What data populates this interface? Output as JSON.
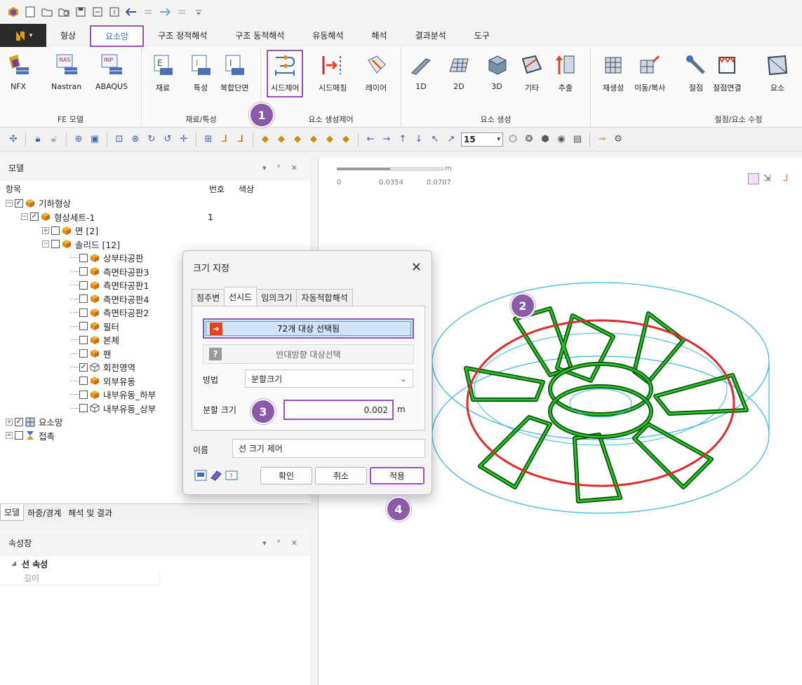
{
  "menu": {
    "tabs": [
      "형상",
      "요소망",
      "구조 정적해석",
      "구조 동적해석",
      "유동해석",
      "해석",
      "결과분석",
      "도구"
    ],
    "active_tab": "요소망"
  },
  "ribbon": {
    "groups": [
      {
        "label": "FE 모델",
        "buttons": [
          "NFX",
          "Nastran",
          "ABAQUS"
        ]
      },
      {
        "label": "재료/특성",
        "buttons": [
          "재료",
          "특성",
          "복합단면"
        ]
      },
      {
        "label": "요소 생성제어",
        "buttons": [
          "시드제어",
          "시드매칭",
          "레이어"
        ]
      },
      {
        "label": "요소 생성",
        "buttons": [
          "1D",
          "2D",
          "3D",
          "기타",
          "추출"
        ]
      },
      {
        "label": "절점/요소 수정",
        "buttons": [
          "재생성",
          "이동/복사",
          "절점",
          "절점연결",
          "요소"
        ]
      }
    ],
    "nas_tag": "NAS",
    "inp_tag": "INP"
  },
  "toolbar": {
    "zoom_value": "15"
  },
  "model_panel": {
    "title": "모델",
    "col_item": "항목",
    "col_number": "번호",
    "col_color": "색상",
    "tree": [
      {
        "label": "기하형상",
        "level": 0,
        "checked": true,
        "expand": "-",
        "num": ""
      },
      {
        "label": "형상세트-1",
        "level": 1,
        "checked": true,
        "expand": "-",
        "num": "1"
      },
      {
        "label": "면 [2]",
        "level": 2,
        "checked": false,
        "expand": "+",
        "num": ""
      },
      {
        "label": "솔리드 [12]",
        "level": 2,
        "checked": false,
        "expand": "-",
        "num": ""
      },
      {
        "label": "상부타공판",
        "level": 3,
        "checked": false,
        "expand": "",
        "num": ""
      },
      {
        "label": "측면타공판3",
        "level": 3,
        "checked": false,
        "expand": "",
        "num": ""
      },
      {
        "label": "측면타공판1",
        "level": 3,
        "checked": false,
        "expand": "",
        "num": ""
      },
      {
        "label": "측면타공판4",
        "level": 3,
        "checked": false,
        "expand": "",
        "num": ""
      },
      {
        "label": "측면타공판2",
        "level": 3,
        "checked": false,
        "expand": "",
        "num": ""
      },
      {
        "label": "필터",
        "level": 3,
        "checked": false,
        "expand": "",
        "num": ""
      },
      {
        "label": "본체",
        "level": 3,
        "checked": false,
        "expand": "",
        "num": ""
      },
      {
        "label": "팬",
        "level": 3,
        "checked": false,
        "expand": "",
        "num": ""
      },
      {
        "label": "회전영역",
        "level": 3,
        "checked": true,
        "expand": "",
        "num": ""
      },
      {
        "label": "외부유동",
        "level": 3,
        "checked": false,
        "expand": "",
        "num": ""
      },
      {
        "label": "내부유동_하부",
        "level": 3,
        "checked": false,
        "expand": "",
        "num": ""
      },
      {
        "label": "내부유동_상부",
        "level": 3,
        "checked": false,
        "expand": "",
        "num": ""
      },
      {
        "label": "요소망",
        "level": 0,
        "checked": true,
        "expand": "+",
        "num": ""
      },
      {
        "label": "접촉",
        "level": 0,
        "checked": false,
        "expand": "+",
        "num": ""
      }
    ]
  },
  "bottom_tabs": [
    "모델",
    "하중/경계",
    "해석 및 결과"
  ],
  "properties": {
    "title": "속성창",
    "category": "선 속성",
    "row": "길이"
  },
  "viewport": {
    "scale_unit": "m",
    "scale_ticks": [
      "0",
      "0.0354",
      "0.0707"
    ]
  },
  "dialog": {
    "title": "크기 지정",
    "tabs": [
      "점주변",
      "선시드",
      "임의크기",
      "자동적합해석"
    ],
    "active_tab": "선시드",
    "select_button": "72개 대상 선택됨",
    "reverse_button": "반대방향 대상선택",
    "method_label": "방법",
    "method_value": "분할크기",
    "division_label": "분할 크기",
    "division_value": "0.002",
    "division_unit": "m",
    "name_label": "이름",
    "name_value": "선 크기 제어",
    "ok": "확인",
    "cancel": "취소",
    "apply": "적용"
  },
  "steps": [
    "1",
    "2",
    "3",
    "4"
  ],
  "colors": {
    "accent": "#9a52c0",
    "badge": "#8b5aa8",
    "mesh_green": "#1fbf1f",
    "ring_red": "#e02a2a",
    "ring_cyan": "#33b8e6"
  }
}
